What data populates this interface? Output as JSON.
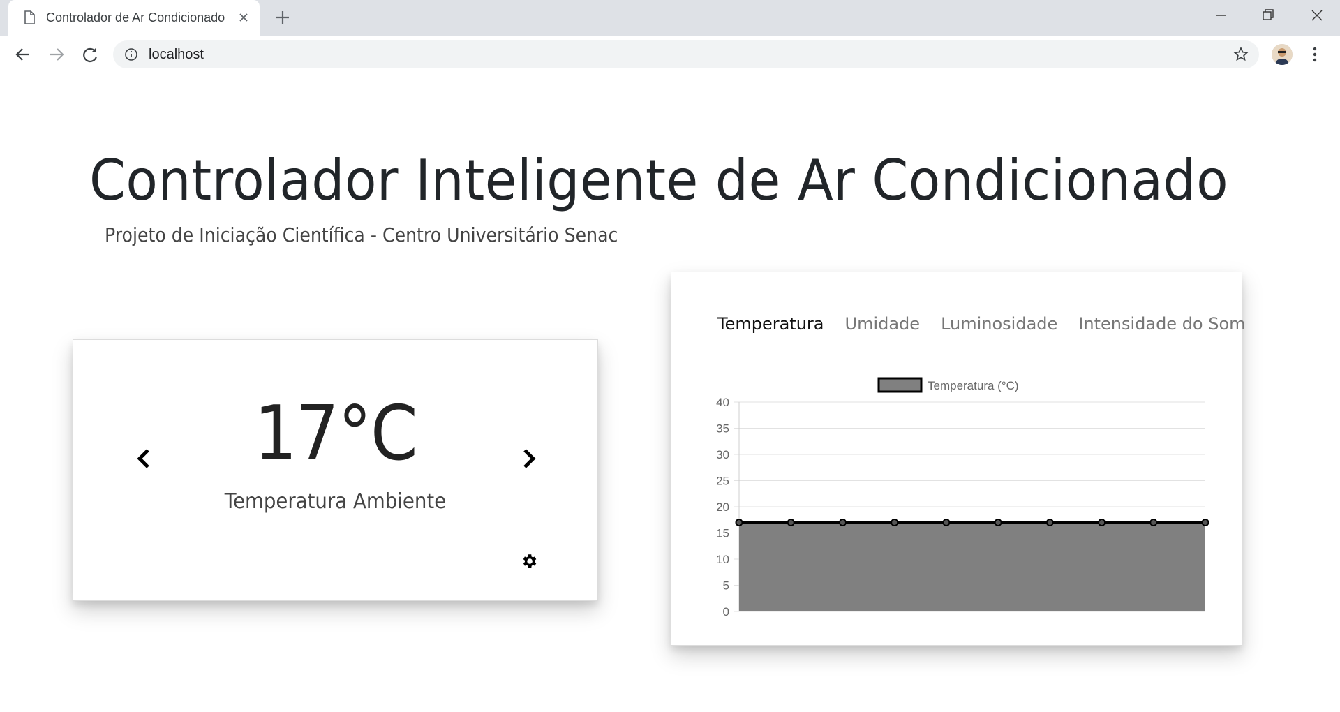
{
  "browser": {
    "tab_title": "Controlador de Ar Condicionado",
    "url": "localhost"
  },
  "page": {
    "title": "Controlador Inteligente de Ar Condicionado",
    "subtitle": "Projeto de Iniciação Científica - Centro Universitário Senac"
  },
  "temperature_card": {
    "value": "17°C",
    "label": "Temperatura Ambiente"
  },
  "chart_tabs": [
    {
      "label": "Temperatura",
      "active": true
    },
    {
      "label": "Umidade",
      "active": false
    },
    {
      "label": "Luminosidade",
      "active": false
    },
    {
      "label": "Intensidade do Som",
      "active": false
    }
  ],
  "colors": {
    "area_fill": "#808080",
    "line": "#000000"
  },
  "chart_data": {
    "type": "area",
    "legend": "top",
    "grid": true,
    "ylim": [
      0,
      40
    ],
    "yticks": [
      0,
      5,
      10,
      15,
      20,
      25,
      30,
      35,
      40
    ],
    "series": [
      {
        "name": "Temperatura (°C)",
        "values": [
          17,
          17,
          17,
          17,
          17,
          17,
          17,
          17,
          17,
          17
        ]
      }
    ]
  }
}
